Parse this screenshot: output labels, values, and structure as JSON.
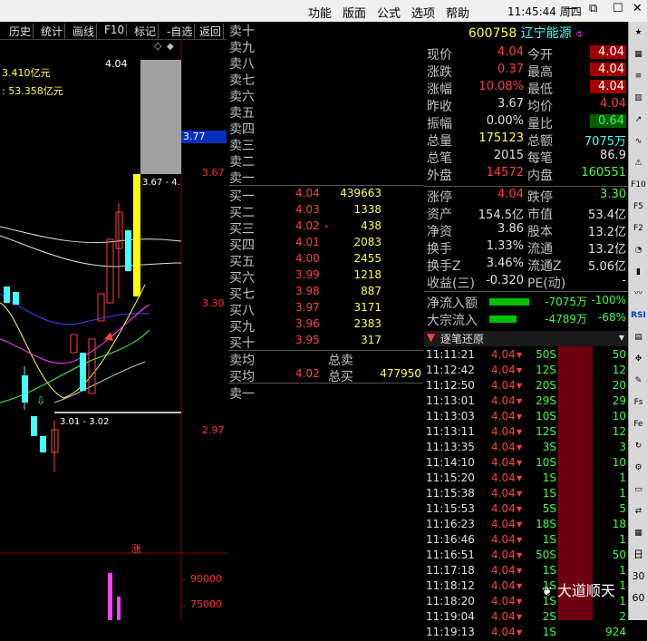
{
  "menubar": {
    "items": [
      "功能",
      "版面",
      "公式",
      "选项",
      "帮助"
    ],
    "clock": "11:45:44",
    "weekday": "周四"
  },
  "toolbar": {
    "items": [
      "历史",
      "统计",
      "画线",
      "F10",
      "标记",
      "-自选",
      "返回"
    ]
  },
  "chart": {
    "overlay1": "3.410亿元",
    "overlay2": ": 53.358亿元",
    "y_labels": [
      "3.67",
      "3.30",
      "2.97",
      "90000",
      "75000"
    ],
    "current_price_tag": "3.77",
    "peak_label": "4.04",
    "range_label_top": "3.67 - 4.",
    "range_label_bottom": "3.01 - 3.02",
    "limit_marker": "涨"
  },
  "quote": {
    "sell": [
      {
        "label": "卖十"
      },
      {
        "label": "卖九"
      },
      {
        "label": "卖八"
      },
      {
        "label": "卖七"
      },
      {
        "label": "卖六"
      },
      {
        "label": "卖五"
      },
      {
        "label": "卖四"
      },
      {
        "label": "卖三"
      },
      {
        "label": "卖二"
      },
      {
        "label": "卖一"
      }
    ],
    "buy": [
      {
        "label": "买一",
        "price": "4.04",
        "vol": "439663"
      },
      {
        "label": "买二",
        "price": "4.03",
        "vol": "1338"
      },
      {
        "label": "买三",
        "price": "4.02",
        "vol": "438",
        "dot": "•"
      },
      {
        "label": "买四",
        "price": "4.01",
        "vol": "2083"
      },
      {
        "label": "买五",
        "price": "4.00",
        "vol": "2455"
      },
      {
        "label": "买六",
        "price": "3.99",
        "vol": "1218"
      },
      {
        "label": "买七",
        "price": "3.98",
        "vol": "887"
      },
      {
        "label": "买八",
        "price": "3.97",
        "vol": "3171"
      },
      {
        "label": "买九",
        "price": "3.96",
        "vol": "2383"
      },
      {
        "label": "买十",
        "price": "3.95",
        "vol": "317"
      }
    ],
    "sell_avg_label": "卖均",
    "total_sell_label": "总卖",
    "buy_avg_label": "买均",
    "buy_avg": "4.02",
    "total_buy_label": "总买",
    "total_buy": "477950",
    "sell_one_label": "卖一"
  },
  "stock": {
    "code": "600758",
    "name": "辽宁能源",
    "badge": "⑤"
  },
  "stats": [
    {
      "l1": "现价",
      "v1": "4.04",
      "c1": "red",
      "l2": "今开",
      "v2": "4.04",
      "c2": "red",
      "box2": true
    },
    {
      "l1": "涨跌",
      "v1": "0.37",
      "c1": "red",
      "l2": "最高",
      "v2": "4.04",
      "c2": "red",
      "box2": true
    },
    {
      "l1": "涨幅",
      "v1": "10.08%",
      "c1": "red",
      "l2": "最低",
      "v2": "4.04",
      "c2": "red",
      "box2": true
    },
    {
      "l1": "昨收",
      "v1": "3.67",
      "c1": "wht",
      "l2": "均价",
      "v2": "4.04",
      "c2": "red"
    },
    {
      "l1": "振幅",
      "v1": "0.00%",
      "c1": "wht",
      "l2": "量比",
      "v2": "0.64",
      "c2": "grn",
      "boxg2": true
    },
    {
      "l1": "总量",
      "v1": "175123",
      "c1": "yel",
      "l2": "总额",
      "v2": "7075万",
      "c2": "cyn"
    },
    {
      "l1": "总笔",
      "v1": "2015",
      "c1": "wht",
      "l2": "每笔",
      "v2": "86.9",
      "c2": "wht"
    },
    {
      "l1": "外盘",
      "v1": "14572",
      "c1": "red",
      "l2": "内盘",
      "v2": "160551",
      "c2": "grn"
    }
  ],
  "stats2": [
    {
      "l1": "涨停",
      "v1": "4.04",
      "c1": "red",
      "l2": "跌停",
      "v2": "3.30",
      "c2": "grn"
    },
    {
      "l1": "资产",
      "v1": "154.5亿",
      "c1": "wht",
      "l2": "市值",
      "v2": "53.4亿",
      "c2": "wht"
    },
    {
      "l1": "净资",
      "v1": "3.86",
      "c1": "wht",
      "l2": "股本",
      "v2": "13.2亿",
      "c2": "wht"
    },
    {
      "l1": "换手",
      "v1": "1.33%",
      "c1": "wht",
      "l2": "流通",
      "v2": "13.2亿",
      "c2": "wht"
    },
    {
      "l1": "换手Z",
      "v1": "3.46%",
      "c1": "wht",
      "l2": "流通Z",
      "v2": "5.06亿",
      "c2": "wht"
    },
    {
      "l1": "收益(三)",
      "v1": "-0.320",
      "c1": "wht",
      "l2": "PE(动)",
      "v2": "-",
      "c2": "wht"
    }
  ],
  "flow": [
    {
      "label": "净流入额",
      "value": "-7075万",
      "pct": "-100%",
      "fill": 1.0
    },
    {
      "label": "大宗流入",
      "value": "-4789万",
      "pct": "-68%",
      "fill": 0.68
    }
  ],
  "ticks_header": "逐笔还原",
  "ticks": [
    {
      "t": "11:11:21",
      "p": "4.04",
      "v": "50S",
      "n": "50"
    },
    {
      "t": "11:12:42",
      "p": "4.04",
      "v": "12S",
      "n": "12"
    },
    {
      "t": "11:12:50",
      "p": "4.04",
      "v": "20S",
      "n": "20"
    },
    {
      "t": "11:13:01",
      "p": "4.04",
      "v": "29S",
      "n": "29"
    },
    {
      "t": "11:13:03",
      "p": "4.04",
      "v": "10S",
      "n": "10"
    },
    {
      "t": "11:13:11",
      "p": "4.04",
      "v": "12S",
      "n": "12"
    },
    {
      "t": "11:13:35",
      "p": "4.04",
      "v": "3S",
      "n": "3"
    },
    {
      "t": "11:14:10",
      "p": "4.04",
      "v": "10S",
      "n": "10"
    },
    {
      "t": "11:15:20",
      "p": "4.04",
      "v": "1S",
      "n": "1"
    },
    {
      "t": "11:15:38",
      "p": "4.04",
      "v": "1S",
      "n": "1"
    },
    {
      "t": "11:15:53",
      "p": "4.04",
      "v": "5S",
      "n": "5"
    },
    {
      "t": "11:16:23",
      "p": "4.04",
      "v": "18S",
      "n": "18"
    },
    {
      "t": "11:16:46",
      "p": "4.04",
      "v": "1S",
      "n": "1"
    },
    {
      "t": "11:16:51",
      "p": "4.04",
      "v": "50S",
      "n": "50"
    },
    {
      "t": "11:17:18",
      "p": "4.04",
      "v": "1S",
      "n": "1"
    },
    {
      "t": "11:18:12",
      "p": "4.04",
      "v": "1S",
      "n": "1"
    },
    {
      "t": "11:18:20",
      "p": "4.04",
      "v": "1S",
      "n": "1"
    },
    {
      "t": "11:19:04",
      "p": "4.04",
      "v": "2S",
      "n": "2"
    },
    {
      "t": "11:19:13",
      "p": "4.04",
      "v": "1S",
      "n": "924"
    }
  ],
  "sidebar": [
    "RSI",
    "F10",
    "F5",
    "F2",
    "日",
    "30",
    "60"
  ],
  "watermark": "大道顺天"
}
